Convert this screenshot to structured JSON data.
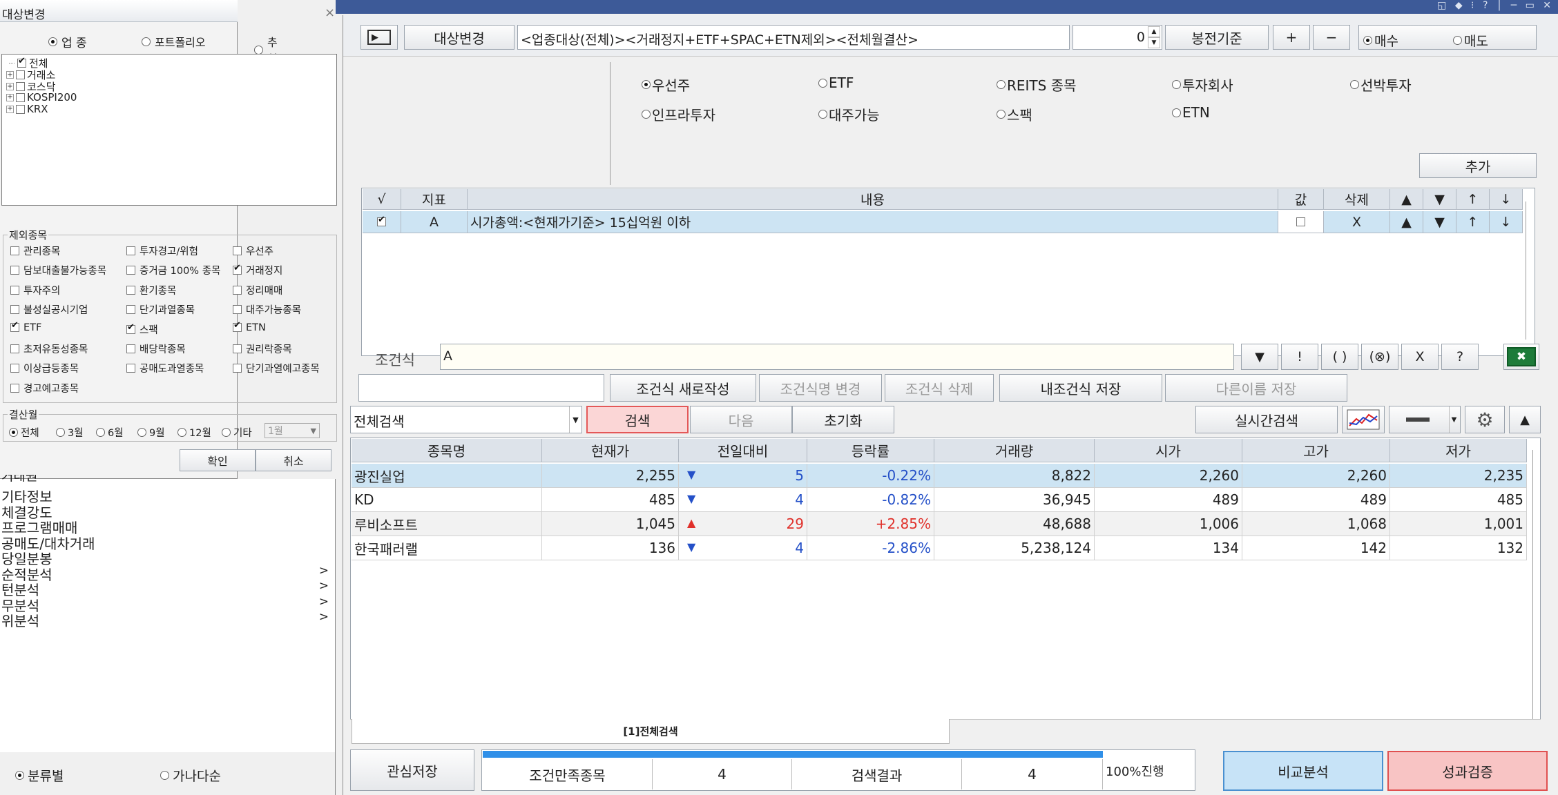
{
  "window_title": "대상변경",
  "target_panel": {
    "radios": [
      {
        "label": "업 종",
        "on": true
      },
      {
        "label": "포트폴리오",
        "on": false
      },
      {
        "label": "추 천",
        "on": false
      }
    ],
    "tree": {
      "root": "전체",
      "children": [
        "거래소",
        "코스닥",
        "KOSPI200",
        "KRX"
      ]
    },
    "exclude_title": "제외종목",
    "exclude_items": [
      {
        "label": "관리종목",
        "on": false
      },
      {
        "label": "투자경고/위험",
        "on": false
      },
      {
        "label": "우선주",
        "on": false
      },
      {
        "label": "담보대출불가능종목",
        "on": false
      },
      {
        "label": "증거금 100% 종목",
        "on": false
      },
      {
        "label": "거래정지",
        "on": true
      },
      {
        "label": "투자주의",
        "on": false
      },
      {
        "label": "환기종목",
        "on": false
      },
      {
        "label": "정리매매",
        "on": false
      },
      {
        "label": "불성실공시기업",
        "on": false
      },
      {
        "label": "단기과열종목",
        "on": false
      },
      {
        "label": "대주가능종목",
        "on": false
      },
      {
        "label": "ETF",
        "on": true
      },
      {
        "label": "스팩",
        "on": true
      },
      {
        "label": "ETN",
        "on": true
      },
      {
        "label": "초저유동성종목",
        "on": false
      },
      {
        "label": "배당락종목",
        "on": false
      },
      {
        "label": "권리락종목",
        "on": false
      },
      {
        "label": "이상급등종목",
        "on": false
      },
      {
        "label": "공매도과열종목",
        "on": false
      },
      {
        "label": "단기과열예고종목",
        "on": false
      },
      {
        "label": "경고예고종목",
        "on": false
      }
    ],
    "settle_title": "결산월",
    "settle_options": [
      {
        "label": "전체",
        "on": true
      },
      {
        "label": "3월",
        "on": false
      },
      {
        "label": "6월",
        "on": false
      },
      {
        "label": "9월",
        "on": false
      },
      {
        "label": "12월",
        "on": false
      },
      {
        "label": "기타",
        "on": false
      }
    ],
    "settle_select": "1월",
    "ok": "확인",
    "cancel": "취소"
  },
  "left_menu": {
    "partial_top": "거래원",
    "items": [
      {
        "label": "기타정보",
        "arrow": ""
      },
      {
        "label": "체결강도",
        "arrow": ""
      },
      {
        "label": "프로그램매매",
        "arrow": ""
      },
      {
        "label": "공매도/대차거래",
        "arrow": ""
      },
      {
        "label": "당일분봉",
        "arrow": ""
      },
      {
        "label": "순적분석",
        "arrow": ">"
      },
      {
        "label": "턴분석",
        "arrow": ">"
      },
      {
        "label": "무분석",
        "arrow": ">"
      },
      {
        "label": "위분석",
        "arrow": ">"
      }
    ],
    "bottom_radios": [
      {
        "label": "분류별",
        "on": true
      },
      {
        "label": "가나다순",
        "on": false
      }
    ]
  },
  "toolbar": {
    "target_change": "대상변경",
    "target_text": "<업종대상(전체)><거래정지+ETF+SPAC+ETN제외><전체월결산>",
    "spin_value": "0",
    "candle_basis": "봉전기준",
    "plus": "+",
    "minus": "−",
    "buy": "매수",
    "sell": "매도",
    "buy_on": true
  },
  "type_options": [
    {
      "label": "우선주",
      "on": true
    },
    {
      "label": "ETF",
      "on": false
    },
    {
      "label": "REITS 종목",
      "on": false
    },
    {
      "label": "투자회사",
      "on": false
    },
    {
      "label": "선박투자",
      "on": false
    },
    {
      "label": "인프라투자",
      "on": false
    },
    {
      "label": "대주가능",
      "on": false
    },
    {
      "label": "스팩",
      "on": false
    },
    {
      "label": "ETN",
      "on": false
    }
  ],
  "add_button": "추가",
  "cond_table": {
    "headers": [
      "√",
      "지표",
      "내용",
      "값",
      "삭제",
      "▲",
      "▼",
      "↑",
      "↓"
    ],
    "rows": [
      {
        "checked": true,
        "id": "A",
        "content": "시가총액:<현재가기준> 15십억원 이하",
        "del": "X",
        "up": "▲",
        "down": "▼",
        "top": "↑",
        "bottom": "↓"
      }
    ]
  },
  "formula": {
    "label": "조건식",
    "value": "A",
    "ops": [
      "!",
      "( )",
      "(⊗)",
      "X",
      "?"
    ]
  },
  "formula_buttons": [
    "조건식 새로작성",
    "조건식명 변경",
    "조건식 삭제",
    "내조건식 저장",
    "다른이름 저장"
  ],
  "search_bar": {
    "select": "전체검색",
    "search": "검색",
    "next": "다음",
    "reset": "초기화",
    "realtime": "실시간검색"
  },
  "results": {
    "headers": [
      "종목명",
      "현재가",
      "전일대비",
      "등락률",
      "거래량",
      "시가",
      "고가",
      "저가"
    ],
    "rows": [
      {
        "name": "광진실업",
        "price": "2,255",
        "dir": "down",
        "diff": "5",
        "rate": "-0.22%",
        "volume": "8,822",
        "open": "2,260",
        "high": "2,260",
        "low": "2,235"
      },
      {
        "name": "KD",
        "price": "485",
        "dir": "down",
        "diff": "4",
        "rate": "-0.82%",
        "volume": "36,945",
        "open": "489",
        "high": "489",
        "low": "485"
      },
      {
        "name": "루비소프트",
        "price": "1,045",
        "dir": "up",
        "diff": "29",
        "rate": "+2.85%",
        "volume": "48,688",
        "open": "1,006",
        "high": "1,068",
        "low": "1,001"
      },
      {
        "name": "한국패러랠",
        "price": "136",
        "dir": "down",
        "diff": "4",
        "rate": "-2.86%",
        "volume": "5,238,124",
        "open": "134",
        "high": "142",
        "low": "132"
      }
    ]
  },
  "tab_label": "[1]전체검색",
  "footer": {
    "save_interest": "관심저장",
    "met_label": "조건만족종목",
    "met_value": "4",
    "result_label": "검색결과",
    "result_value": "4",
    "progress_text": "100%진행",
    "progress": 1.0,
    "compare": "비교분석",
    "perf": "성과검증"
  },
  "colors": {
    "titlebar": "#3d5a98",
    "selected_row": "#cde4f3",
    "up": "#e0302a",
    "down": "#2450c8",
    "progress": "#2f8fe8",
    "compare_bg": "#c7e3f7",
    "perf_bg": "#f8c4c4"
  }
}
